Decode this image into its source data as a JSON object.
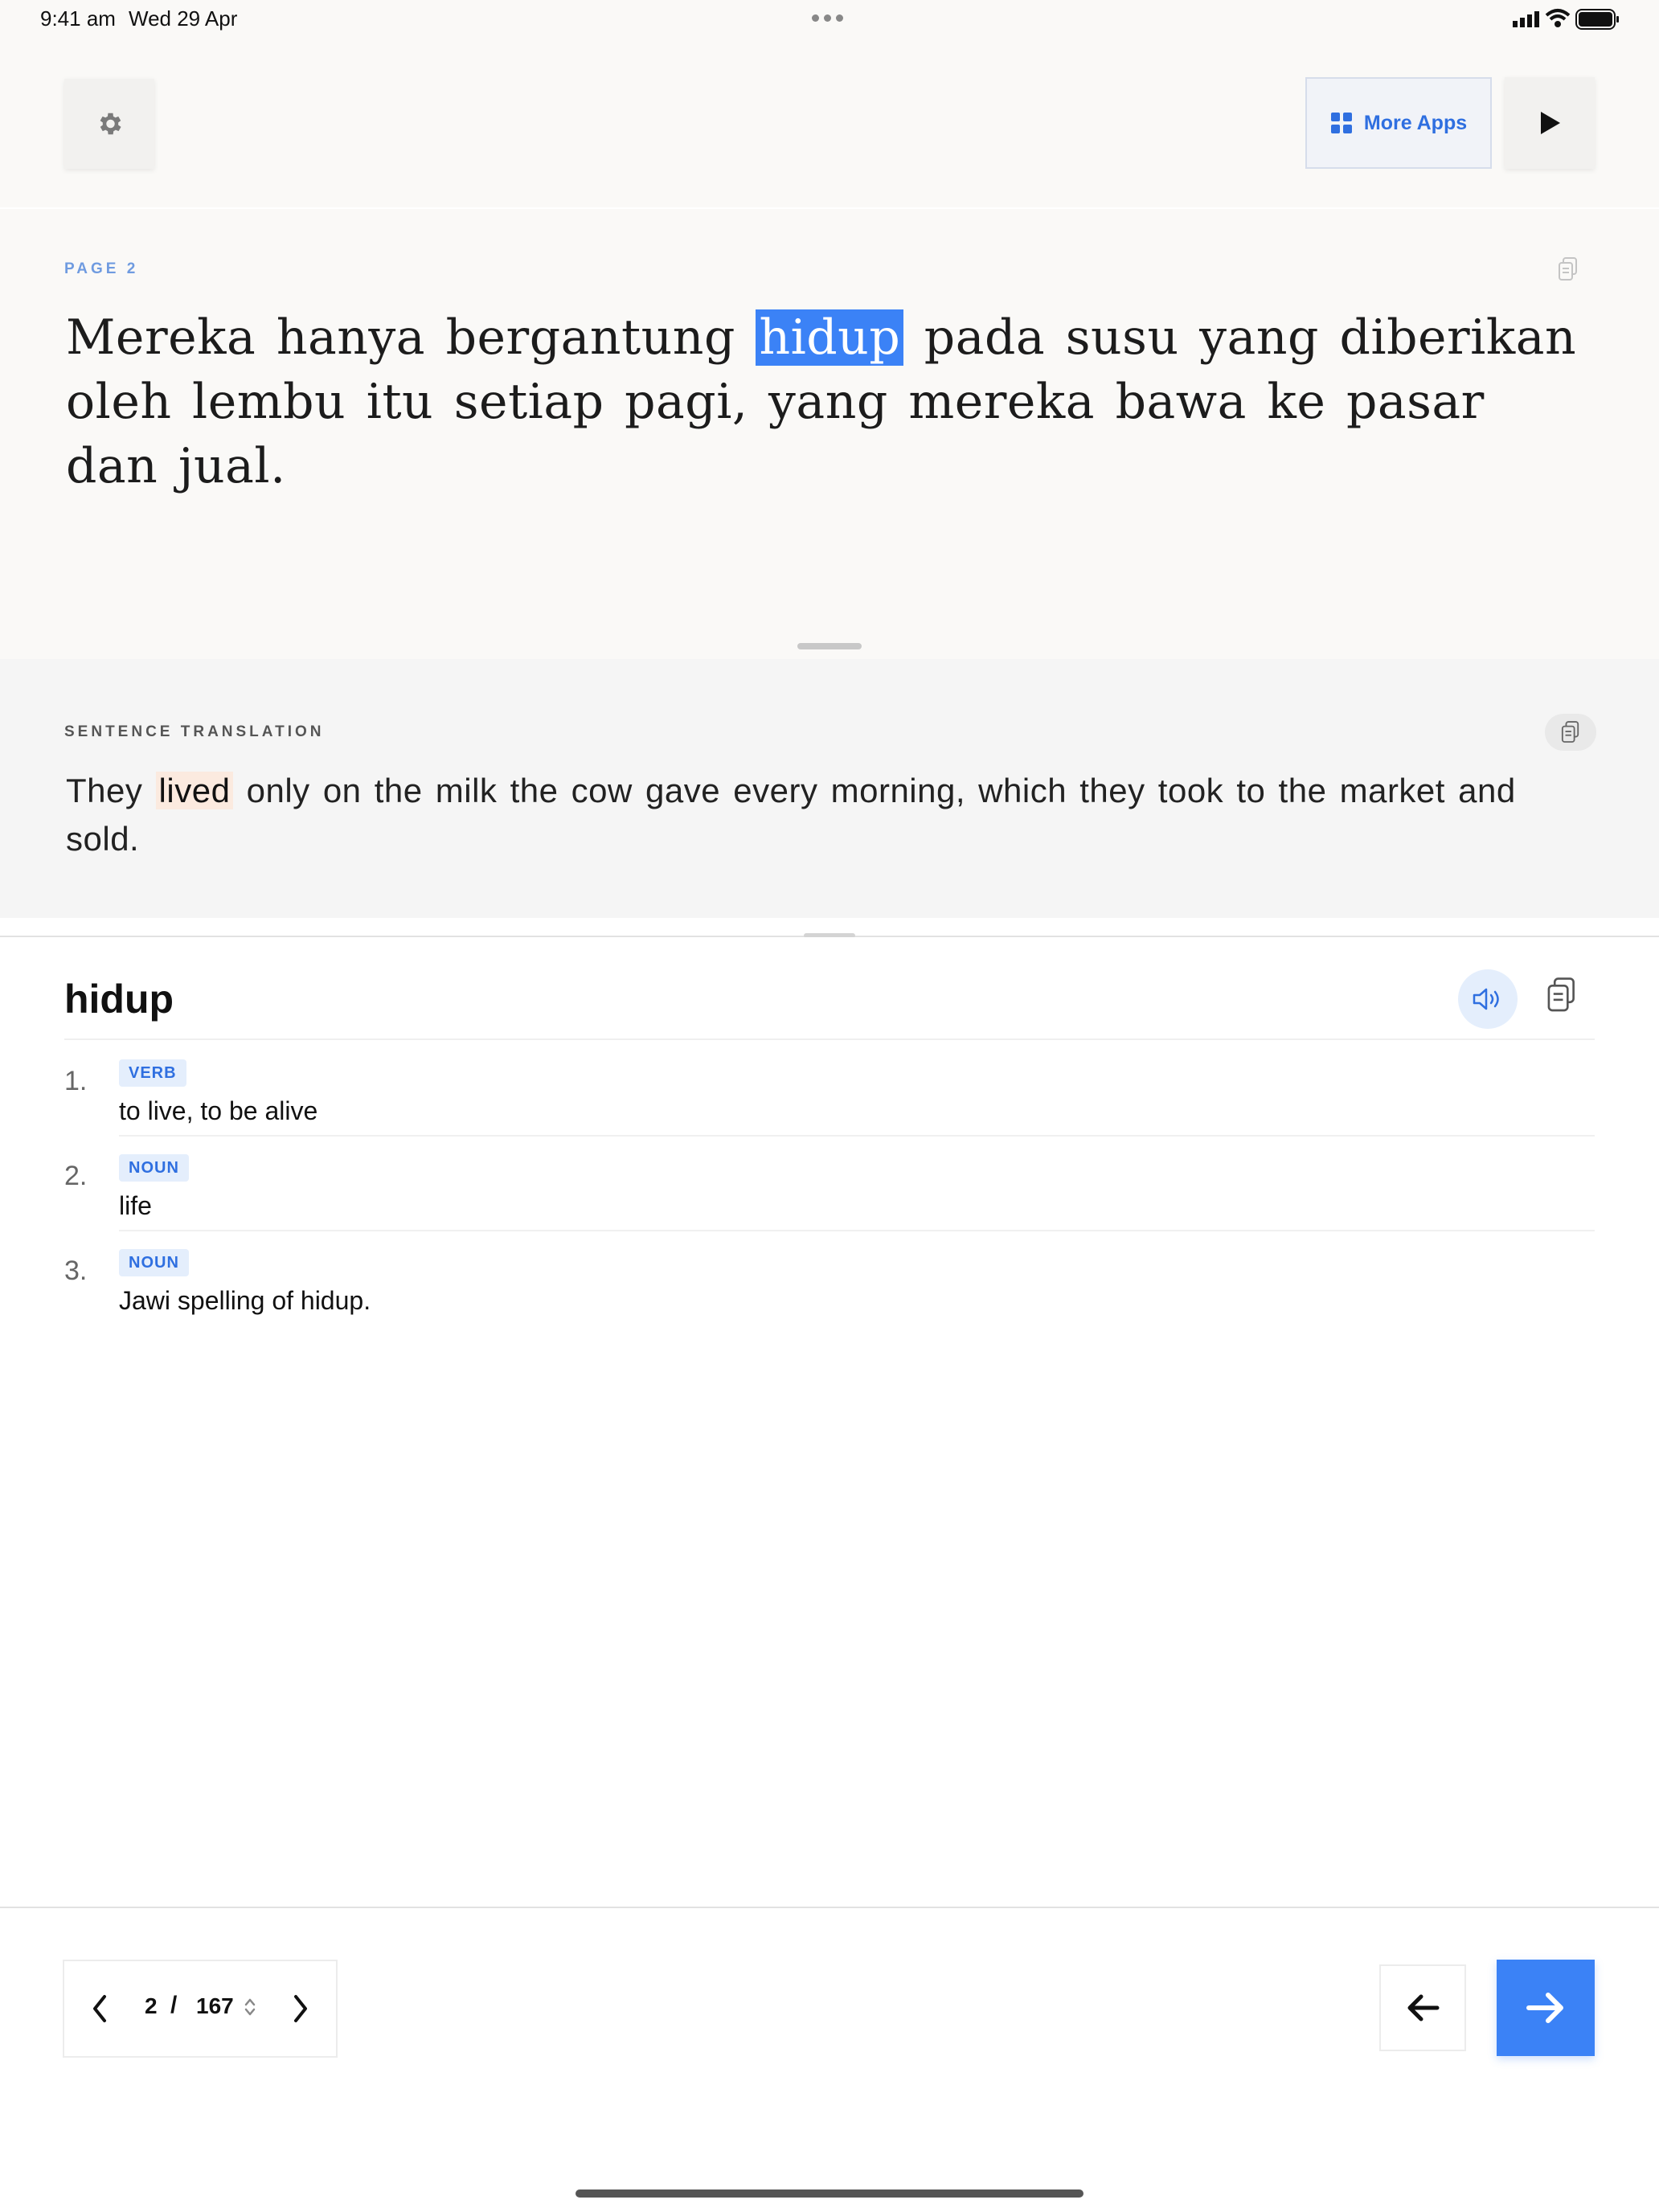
{
  "status_bar": {
    "time": "9:41 am",
    "date": "Wed 29 Apr"
  },
  "toolbar": {
    "settings_icon": "gear-icon",
    "more_apps_label": "More Apps",
    "more_apps_icon": "grid-icon",
    "play_icon": "play-icon",
    "reading_progress": 0.006
  },
  "reading": {
    "page_label": "PAGE 2",
    "sentence_before": "Mereka hanya bergantung ",
    "highlighted_word": "hidup",
    "sentence_after": " pada susu yang diberikan oleh lembu itu setiap pagi, yang mereka bawa ke pasar dan jual."
  },
  "translation": {
    "label": "SENTENCE TRANSLATION",
    "text_before": "They ",
    "highlighted_word": "lived",
    "text_after": " only on the milk the cow gave every morning, which they took to the market and sold."
  },
  "dictionary": {
    "word": "hidup",
    "definitions": [
      {
        "number": "1.",
        "pos": "VERB",
        "text": "to live, to be alive"
      },
      {
        "number": "2.",
        "pos": "NOUN",
        "text": "life"
      },
      {
        "number": "3.",
        "pos": "NOUN",
        "text": "Jawi spelling of hidup."
      }
    ]
  },
  "pagination": {
    "current": "2",
    "separator": "/",
    "total": "167"
  },
  "colors": {
    "accent": "#3b82f6",
    "highlight_translation": "#fbeadf",
    "badge_bg": "#e4eefc"
  }
}
